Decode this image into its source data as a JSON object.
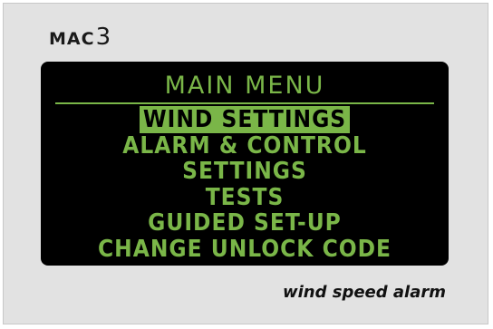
{
  "logo": {
    "brand": "MAC",
    "model_number": "3"
  },
  "screen": {
    "title": "MAIN MENU",
    "items": [
      {
        "label": "WIND SETTINGS",
        "selected": true
      },
      {
        "label": "ALARM & CONTROL",
        "selected": false
      },
      {
        "label": "SETTINGS",
        "selected": false
      },
      {
        "label": "TESTS",
        "selected": false
      },
      {
        "label": "GUIDED SET-UP",
        "selected": false
      },
      {
        "label": "CHANGE UNLOCK CODE",
        "selected": false
      }
    ]
  },
  "tagline": "wind speed alarm",
  "colors": {
    "lcd_text": "#7ab648",
    "lcd_background": "#000000",
    "panel": "#e2e2e2"
  }
}
